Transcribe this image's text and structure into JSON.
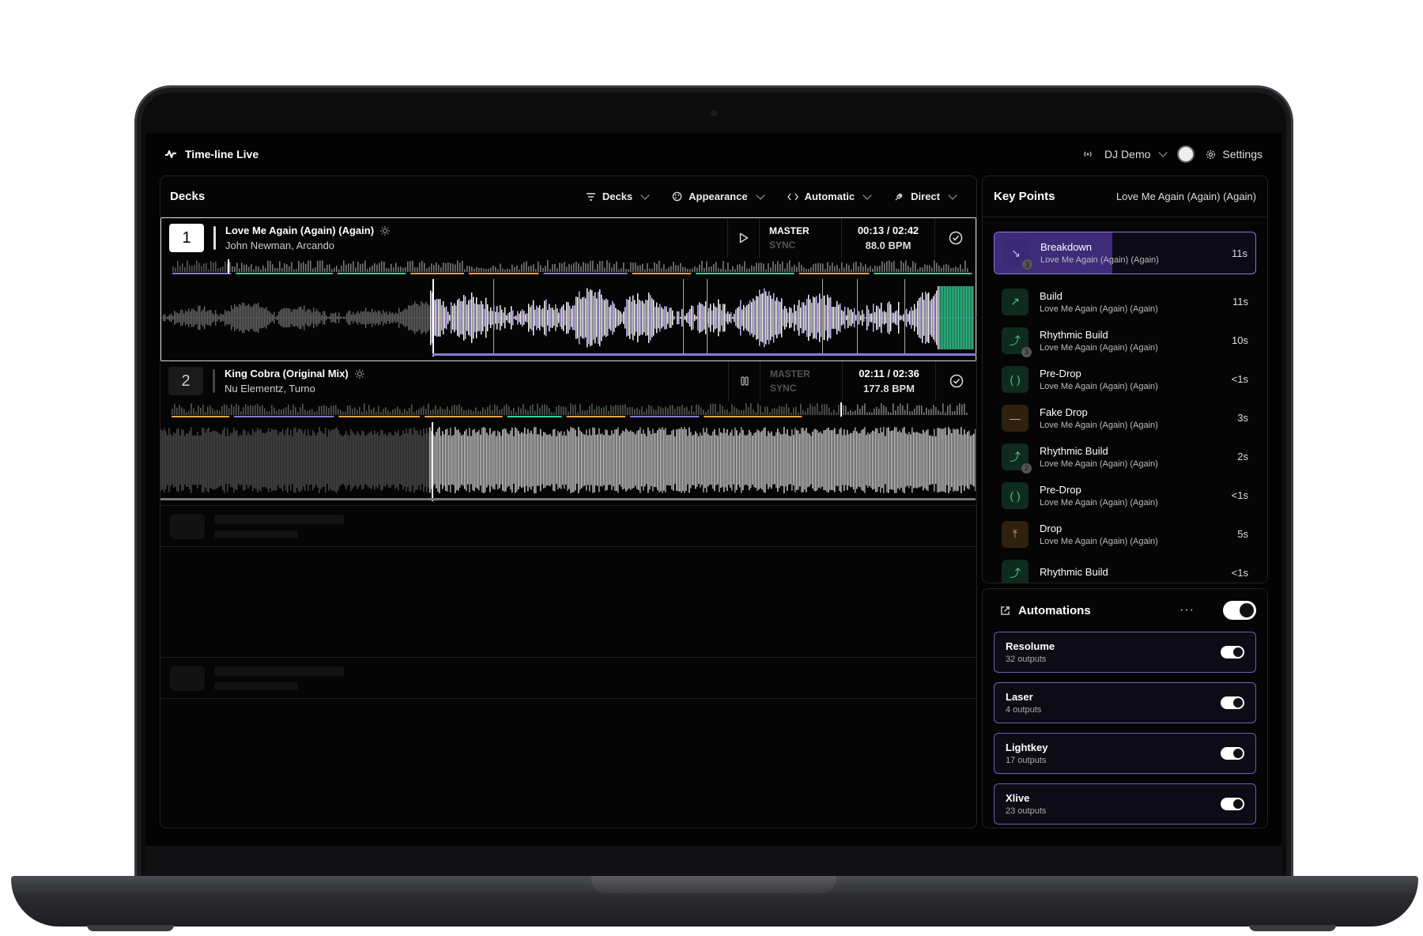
{
  "app": {
    "title": "Time-line Live"
  },
  "header": {
    "user": "DJ Demo",
    "settings_label": "Settings"
  },
  "decks_panel": {
    "title": "Decks",
    "filters": [
      "Decks",
      "Appearance",
      "Automatic",
      "Direct"
    ]
  },
  "decks": [
    {
      "number": "1",
      "title": "Love Me Again (Again) (Again)",
      "artist": "John Newman, Arcando",
      "master": "MASTER",
      "sync": "SYNC",
      "time": "00:13 / 02:42",
      "bpm": "88.0 BPM",
      "state": "play"
    },
    {
      "number": "2",
      "title": "King Cobra (Original Mix)",
      "artist": "Nu Elementz, Turno",
      "master": "MASTER",
      "sync": "SYNC",
      "time": "02:11 / 02:36",
      "bpm": "177.8 BPM",
      "state": "pause"
    }
  ],
  "key_points": {
    "title": "Key Points",
    "track": "Love Me Again (Again) (Again)",
    "items": [
      {
        "name": "Breakdown",
        "sub": "Love Me Again (Again) (Again)",
        "dur": "11s",
        "icon": "arrow-down-right-icon",
        "glyph": "↘",
        "badge": "3",
        "color": "#c7b8ff",
        "bg": "#3a2a76",
        "progress": 0.45
      },
      {
        "name": "Build",
        "sub": "Love Me Again (Again) (Again)",
        "dur": "11s",
        "icon": "arrow-up-right-icon",
        "glyph": "↗",
        "badge": "",
        "color": "#3ecf8e",
        "bg": "#0f2a1e"
      },
      {
        "name": "Rhythmic Build",
        "sub": "Love Me Again (Again) (Again)",
        "dur": "10s",
        "icon": "trend-up-icon",
        "glyph": "⤴",
        "badge": "3",
        "color": "#3ecf8e",
        "bg": "#0f2a1e"
      },
      {
        "name": "Pre-Drop",
        "sub": "Love Me Again (Again) (Again)",
        "dur": "<1s",
        "icon": "parentheses-icon",
        "glyph": "( )",
        "badge": "",
        "color": "#3ecf8e",
        "bg": "#0f2a1e"
      },
      {
        "name": "Fake Drop",
        "sub": "Love Me Again (Again) (Again)",
        "dur": "3s",
        "icon": "dash-icon",
        "glyph": "—",
        "badge": "",
        "color": "#e8a33c",
        "bg": "#2e2110"
      },
      {
        "name": "Rhythmic Build",
        "sub": "Love Me Again (Again) (Again)",
        "dur": "2s",
        "icon": "trend-up-icon",
        "glyph": "⤴",
        "badge": "2",
        "color": "#3ecf8e",
        "bg": "#0f2a1e"
      },
      {
        "name": "Pre-Drop",
        "sub": "Love Me Again (Again) (Again)",
        "dur": "<1s",
        "icon": "parentheses-icon",
        "glyph": "( )",
        "badge": "",
        "color": "#3ecf8e",
        "bg": "#0f2a1e"
      },
      {
        "name": "Drop",
        "sub": "Love Me Again (Again) (Again)",
        "dur": "5s",
        "icon": "arrow-up-bar-icon",
        "glyph": "⤒",
        "badge": "",
        "color": "#e8a33c",
        "bg": "#2e2110"
      },
      {
        "name": "Rhythmic Build",
        "sub": "",
        "dur": "<1s",
        "icon": "trend-up-icon",
        "glyph": "⤴",
        "badge": "",
        "color": "#3ecf8e",
        "bg": "#0f2a1e"
      }
    ]
  },
  "automations": {
    "title": "Automations",
    "items": [
      {
        "name": "Resolume",
        "sub": "32 outputs"
      },
      {
        "name": "Laser",
        "sub": "4 outputs"
      },
      {
        "name": "Lightkey",
        "sub": "17 outputs"
      },
      {
        "name": "Xlive",
        "sub": "23 outputs"
      }
    ]
  },
  "colors": {
    "accent": "#8a79d6",
    "green": "#3ecf8e",
    "orange": "#e8a33c",
    "purple_wave": "#c9b6ff"
  }
}
